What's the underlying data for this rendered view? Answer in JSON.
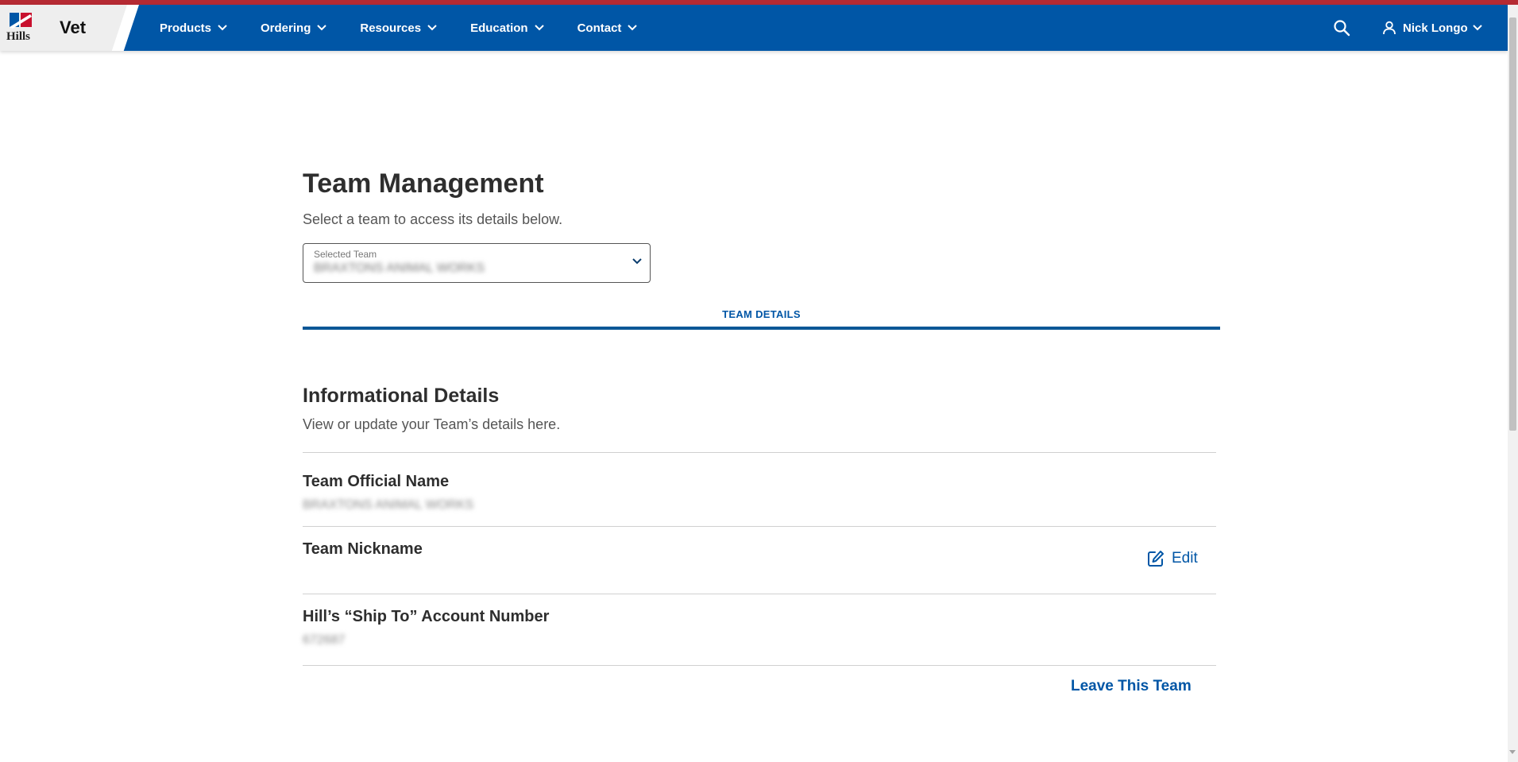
{
  "brand": {
    "logo_text": "Hills",
    "product_name": "Vet",
    "colors": {
      "nav_blue": "#0056a6",
      "stripe_red": "#b52a33",
      "logo_red": "#c8102e",
      "logo_blue": "#0056a6"
    }
  },
  "nav": {
    "items": [
      {
        "label": "Products",
        "icon": "chevron-down-icon"
      },
      {
        "label": "Ordering",
        "icon": "chevron-down-icon"
      },
      {
        "label": "Resources",
        "icon": "chevron-down-icon"
      },
      {
        "label": "Education",
        "icon": "chevron-down-icon"
      },
      {
        "label": "Contact",
        "icon": "chevron-down-icon"
      }
    ],
    "search_icon": "search-icon",
    "user": {
      "name": "Nick Longo",
      "icon": "user-icon"
    }
  },
  "page": {
    "title": "Team Management",
    "subtitle": "Select a team to access its details below."
  },
  "team_select": {
    "label": "Selected Team",
    "value": "BRAXTONS ANIMAL WORKS"
  },
  "tabs": [
    {
      "label": "TEAM DETAILS",
      "active": true
    }
  ],
  "details": {
    "title": "Informational Details",
    "subtitle": "View or update your Team’s details here.",
    "official_name_label": "Team Official Name",
    "official_name_value": "BRAXTONS ANIMAL WORKS",
    "nickname_label": "Team Nickname",
    "edit_label": "Edit",
    "account_label": "Hill’s “Ship To” Account Number",
    "account_value": "672687",
    "leave_label": "Leave This Team"
  }
}
